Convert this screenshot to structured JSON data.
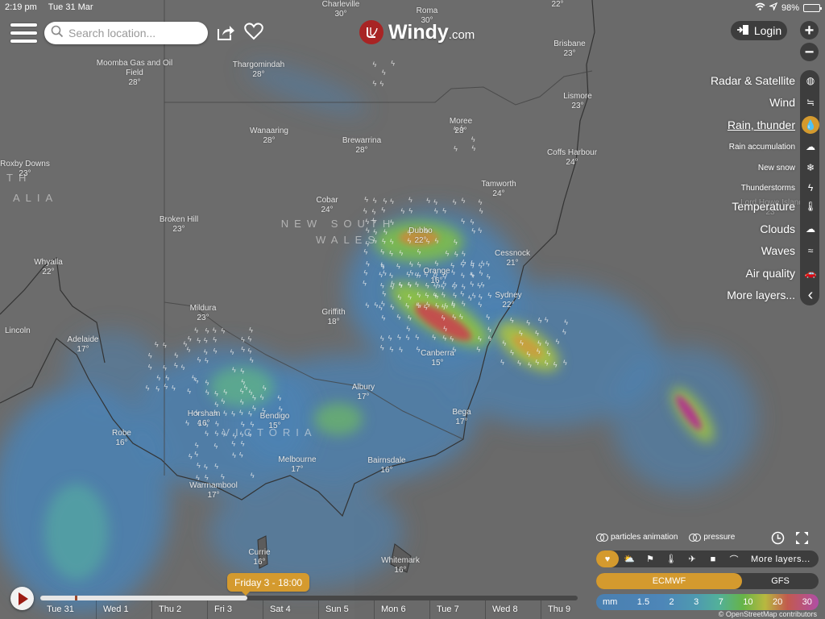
{
  "status_bar": {
    "time": "2:19 pm",
    "date": "Tue 31 Mar",
    "battery": "98%",
    "battery_level": 0.98
  },
  "header": {
    "search_placeholder": "Search location...",
    "logo_main": "Windy",
    "logo_suffix": ".com",
    "login_label": "Login",
    "zoom_in": "+",
    "zoom_out": "−"
  },
  "layers": [
    {
      "label": "Radar & Satellite",
      "icon": "globe-icon",
      "glyph": "◍",
      "size": "big",
      "active": false
    },
    {
      "label": "Wind",
      "icon": "wind-icon",
      "glyph": "≒",
      "size": "big",
      "active": false
    },
    {
      "label": "Rain, thunder",
      "icon": "raindrop-icon",
      "glyph": "💧",
      "size": "big",
      "active": true
    },
    {
      "label": "Rain accumulation",
      "icon": "rain-cloud-icon",
      "glyph": "☁",
      "size": "small",
      "active": false
    },
    {
      "label": "New snow",
      "icon": "snowflake-icon",
      "glyph": "❄",
      "size": "small",
      "active": false
    },
    {
      "label": "Thunderstorms",
      "icon": "thunder-cloud-icon",
      "glyph": "ϟ",
      "size": "small",
      "active": false
    },
    {
      "label": "Temperature",
      "icon": "thermometer-icon",
      "glyph": "🌡",
      "size": "big",
      "active": false
    },
    {
      "label": "Clouds",
      "icon": "cloud-icon",
      "glyph": "☁",
      "size": "big",
      "active": false
    },
    {
      "label": "Waves",
      "icon": "waves-icon",
      "glyph": "≈",
      "size": "big",
      "active": false
    },
    {
      "label": "Air quality",
      "icon": "car-icon",
      "glyph": "🚗",
      "size": "big",
      "active": false
    },
    {
      "label": "More layers...",
      "icon": "chevron-left-icon",
      "glyph": "‹",
      "size": "big",
      "active": false
    }
  ],
  "overlay_toggles": {
    "particles": "particles animation",
    "pressure": "pressure"
  },
  "favorites": {
    "items": [
      {
        "icon": "heart-icon",
        "glyph": "♥",
        "active": true
      },
      {
        "icon": "sun-cloud-icon",
        "glyph": "⛅",
        "active": false
      },
      {
        "icon": "flag-icon",
        "glyph": "⚑",
        "active": false
      },
      {
        "icon": "thermometer-icon",
        "glyph": "🌡",
        "active": false
      },
      {
        "icon": "airplane-icon",
        "glyph": "✈",
        "active": false
      },
      {
        "icon": "webcam-icon",
        "glyph": "■",
        "active": false
      },
      {
        "icon": "paraglider-icon",
        "glyph": "⌒",
        "active": false
      }
    ],
    "more_label": "More layers..."
  },
  "models": [
    {
      "label": "ECMWF",
      "active": true
    },
    {
      "label": "GFS",
      "active": false
    }
  ],
  "legend": {
    "unit": "mm",
    "values": [
      "1.5",
      "2",
      "3",
      "7",
      "10",
      "20",
      "30"
    ]
  },
  "attribution": "© OpenStreetMap contributors",
  "timeline": {
    "current_label": "Friday 3 - 18:00",
    "progress": 0.385,
    "now_position": 0.064,
    "days": [
      "Tue 31",
      "Wed 1",
      "Thu 2",
      "Fri 3",
      "Sat 4",
      "Sun 5",
      "Mon 6",
      "Tue 7",
      "Wed 8",
      "Thu 9"
    ]
  },
  "map": {
    "cities": [
      {
        "name": "Charleville",
        "temp": "30°"
      },
      {
        "name": "Roma",
        "temp": "30°"
      },
      {
        "name": "",
        "temp": "22°"
      },
      {
        "name": "Brisbane",
        "temp": "23°"
      },
      {
        "name": "Moomba Gas and Oil Field",
        "temp": "28°"
      },
      {
        "name": "Thargomindah",
        "temp": "28°"
      },
      {
        "name": "Lismore",
        "temp": "23°"
      },
      {
        "name": "Moree",
        "temp": "28°"
      },
      {
        "name": "Wanaaring",
        "temp": "28°"
      },
      {
        "name": "Brewarrina",
        "temp": "28°"
      },
      {
        "name": "Coffs Harbour",
        "temp": "24°"
      },
      {
        "name": "Roxby Downs",
        "temp": "23°"
      },
      {
        "name": "Tamworth",
        "temp": "24°"
      },
      {
        "name": "Cobar",
        "temp": "24°"
      },
      {
        "name": "Lord Howe Island",
        "temp": "23°"
      },
      {
        "name": "Broken Hill",
        "temp": "23°"
      },
      {
        "name": "Dubbo",
        "temp": "22°"
      },
      {
        "name": "Cessnock",
        "temp": "21°"
      },
      {
        "name": "Whyalla",
        "temp": "22°"
      },
      {
        "name": "Orange",
        "temp": "16°"
      },
      {
        "name": "Sydney",
        "temp": "22°"
      },
      {
        "name": "Mildura",
        "temp": "23°"
      },
      {
        "name": "Griffith",
        "temp": "18°"
      },
      {
        "name": "Adelaide",
        "temp": "17°"
      },
      {
        "name": "Canberra",
        "temp": "15°"
      },
      {
        "name": "Albury",
        "temp": "17°"
      },
      {
        "name": "Horsham",
        "temp": "16°"
      },
      {
        "name": "Bendigo",
        "temp": "15°"
      },
      {
        "name": "Bega",
        "temp": "17°"
      },
      {
        "name": "Robe",
        "temp": "16°"
      },
      {
        "name": "Melbourne",
        "temp": "17°"
      },
      {
        "name": "Bairnsdale",
        "temp": "16°"
      },
      {
        "name": "Warrnambool",
        "temp": "17°"
      },
      {
        "name": "Currie",
        "temp": "16°"
      },
      {
        "name": "Whitemark",
        "temp": "16°"
      },
      {
        "name": "Lincoln",
        "temp": ""
      }
    ],
    "regions": [
      "NEW SOUTH",
      "WALES",
      "VICTORIA",
      "TH",
      "ALIA"
    ]
  }
}
